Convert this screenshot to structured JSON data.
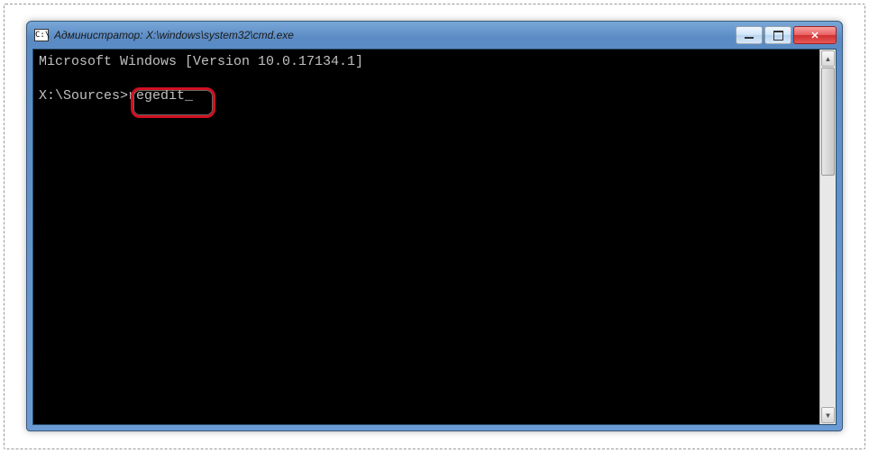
{
  "window": {
    "title": "Администратор: X:\\windows\\system32\\cmd.exe",
    "icon_label": "C:\\"
  },
  "terminal": {
    "line1": "Microsoft Windows [Version 10.0.17134.1]",
    "blank": "",
    "prompt": "X:\\Sources>",
    "command": "regedit"
  },
  "controls": {
    "minimize": "minimize",
    "maximize": "maximize",
    "close": "close"
  }
}
